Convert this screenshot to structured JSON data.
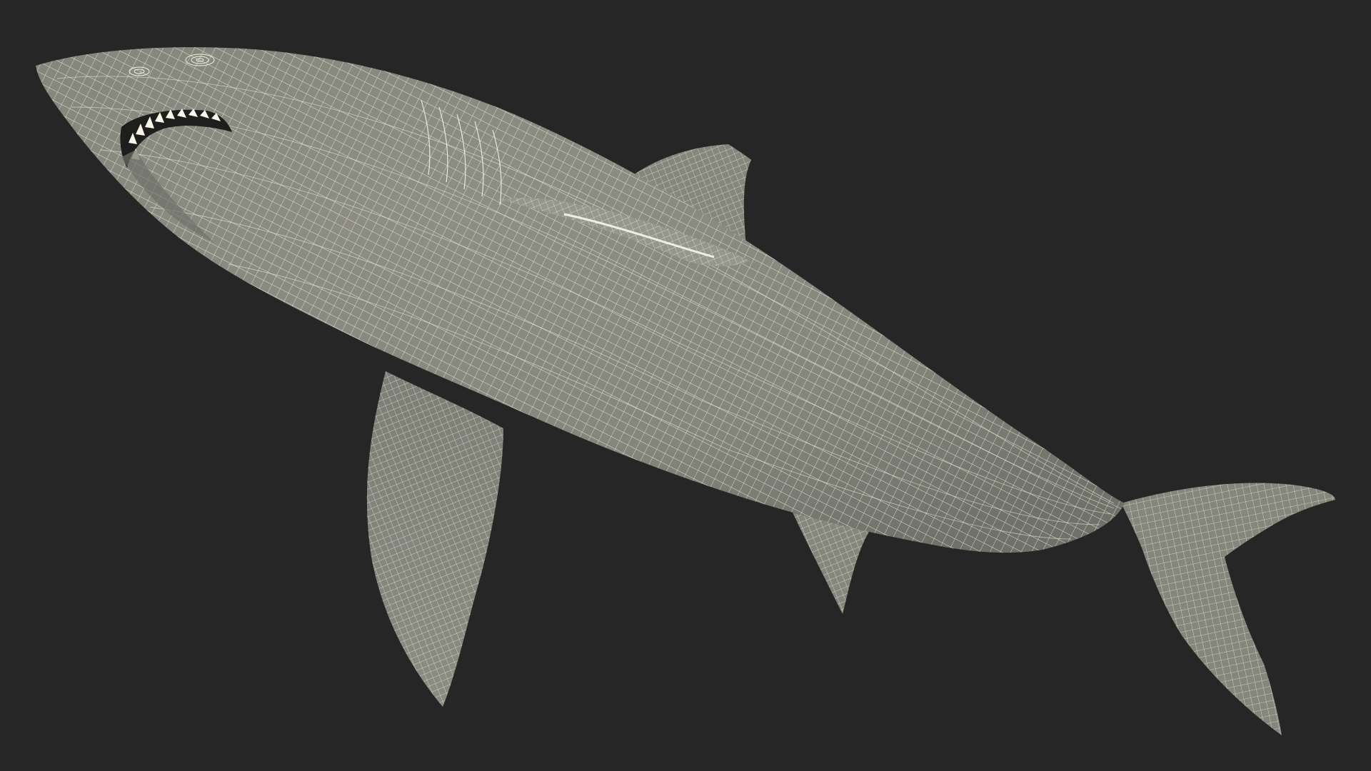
{
  "scene": {
    "subject_icon": "shark-wireframe-icon",
    "colors": {
      "background": "#262626",
      "surface": "#898a80",
      "surface_shadow": "#6f7068",
      "surface_dark": "#4a4b45",
      "wire": "#f4f2e4",
      "teeth": "#f8f6ea",
      "mouth": "#1e1e1c"
    }
  }
}
